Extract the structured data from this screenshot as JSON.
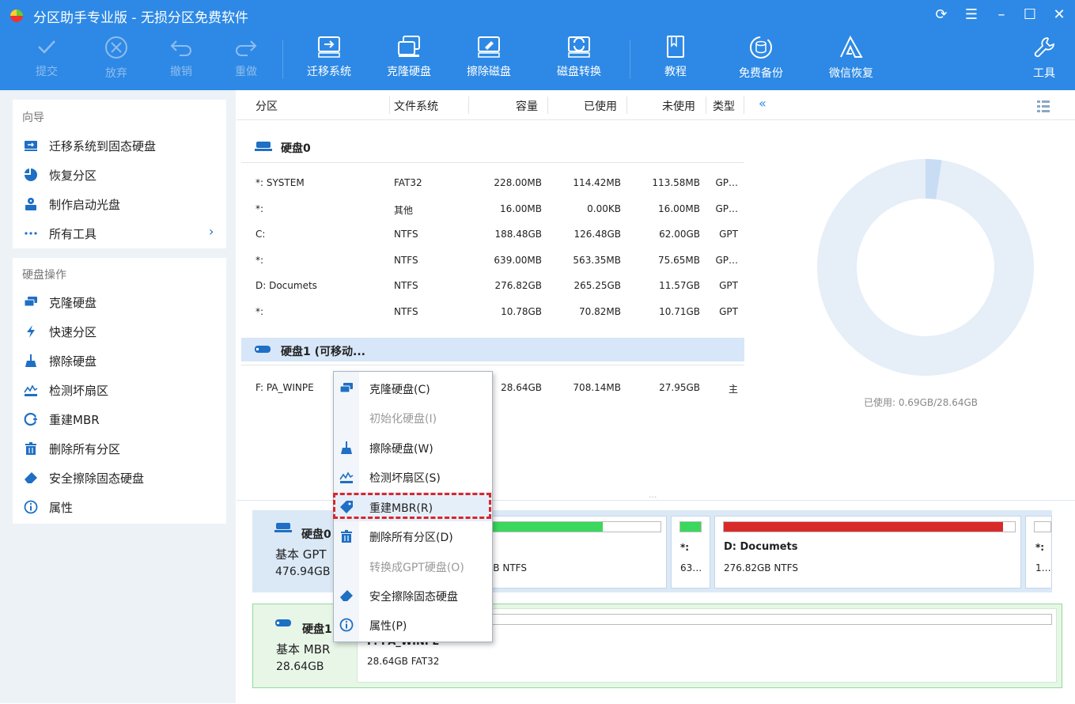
{
  "window": {
    "title": "分区助手专业版 - 无损分区免费软件",
    "controls": [
      "refresh-icon",
      "menu-icon",
      "minimize-icon",
      "maximize-icon",
      "close-icon"
    ]
  },
  "toolbar": {
    "commit": "提交",
    "discard": "放弃",
    "undo": "撤销",
    "redo": "重做",
    "migrate": "迁移系统",
    "clone": "克隆硬盘",
    "wipe": "擦除磁盘",
    "convert": "磁盘转换",
    "tutorial": "教程",
    "backup": "免费备份",
    "wechat": "微信恢复",
    "tools": "工具"
  },
  "wizard": {
    "title": "向导",
    "items": [
      "迁移系统到固态硬盘",
      "恢复分区",
      "制作启动光盘",
      "所有工具"
    ]
  },
  "diskops": {
    "title": "硬盘操作",
    "items": [
      "克隆硬盘",
      "快速分区",
      "擦除硬盘",
      "检测坏扇区",
      "重建MBR",
      "删除所有分区",
      "安全擦除固态硬盘",
      "属性"
    ]
  },
  "table": {
    "headers": [
      "分区",
      "文件系统",
      "容量",
      "已使用",
      "未使用",
      "类型"
    ],
    "collapse": "«",
    "disk0": {
      "label": "硬盘0",
      "rows": [
        [
          "*: SYSTEM",
          "FAT32",
          "228.00MB",
          "114.42MB",
          "113.58MB",
          "GP…"
        ],
        [
          "*:",
          "其他",
          "16.00MB",
          "0.00KB",
          "16.00MB",
          "GP…"
        ],
        [
          "C:",
          "NTFS",
          "188.48GB",
          "126.48GB",
          "62.00GB",
          "GPT"
        ],
        [
          "*:",
          "NTFS",
          "639.00MB",
          "563.35MB",
          "75.65MB",
          "GP…"
        ],
        [
          "D: Documets",
          "NTFS",
          "276.82GB",
          "265.25GB",
          "11.57GB",
          "GPT"
        ],
        [
          "*:",
          "NTFS",
          "10.78GB",
          "70.82MB",
          "10.71GB",
          "GPT"
        ]
      ]
    },
    "disk1": {
      "label": "硬盘1 (可移动...",
      "rows": [
        [
          "F: PA_WINPE",
          "",
          "28.64GB",
          "708.14MB",
          "27.95GB",
          "主"
        ]
      ]
    }
  },
  "donut": {
    "used_label": "已使用: 0.69GB/28.64GB",
    "used_fraction": 0.024
  },
  "diskmap": {
    "disk0": {
      "name": "硬盘0",
      "type": "基本 GPT",
      "size": "476.94GB",
      "partitions": [
        {
          "bar_fill": 0.67,
          "name": "",
          "detail": "GB NTFS"
        },
        {
          "bar_fill": 1.0,
          "name": "*:",
          "detail": "63…"
        },
        {
          "bar_fill": 0.96,
          "name": "D: Documets",
          "detail": "276.82GB NTFS"
        },
        {
          "bar_fill": 0.0,
          "name": "*:",
          "detail": "1…"
        }
      ]
    },
    "disk1": {
      "name": "硬盘1",
      "type": "基本 MBR",
      "size": "28.64GB",
      "partition": {
        "name": "F: PA_WINPE",
        "detail": "28.64GB FAT32",
        "bar_fill": 0.024
      }
    }
  },
  "contextmenu": {
    "items": [
      "克隆硬盘(C)",
      "初始化硬盘(I)",
      "擦除硬盘(W)",
      "检测坏扇区(S)",
      "重建MBR(R)",
      "删除所有分区(D)",
      "转换成GPT硬盘(O)",
      "安全擦除固态硬盘",
      "属性(P)"
    ]
  },
  "colors": {
    "titlebar": "#2d89e5",
    "used_green": "#3ad85c",
    "used_red": "#d92a2a",
    "highlight_border": "#d9262b",
    "donut_free": "#e6eef8",
    "donut_used": "#c8ddf4"
  }
}
